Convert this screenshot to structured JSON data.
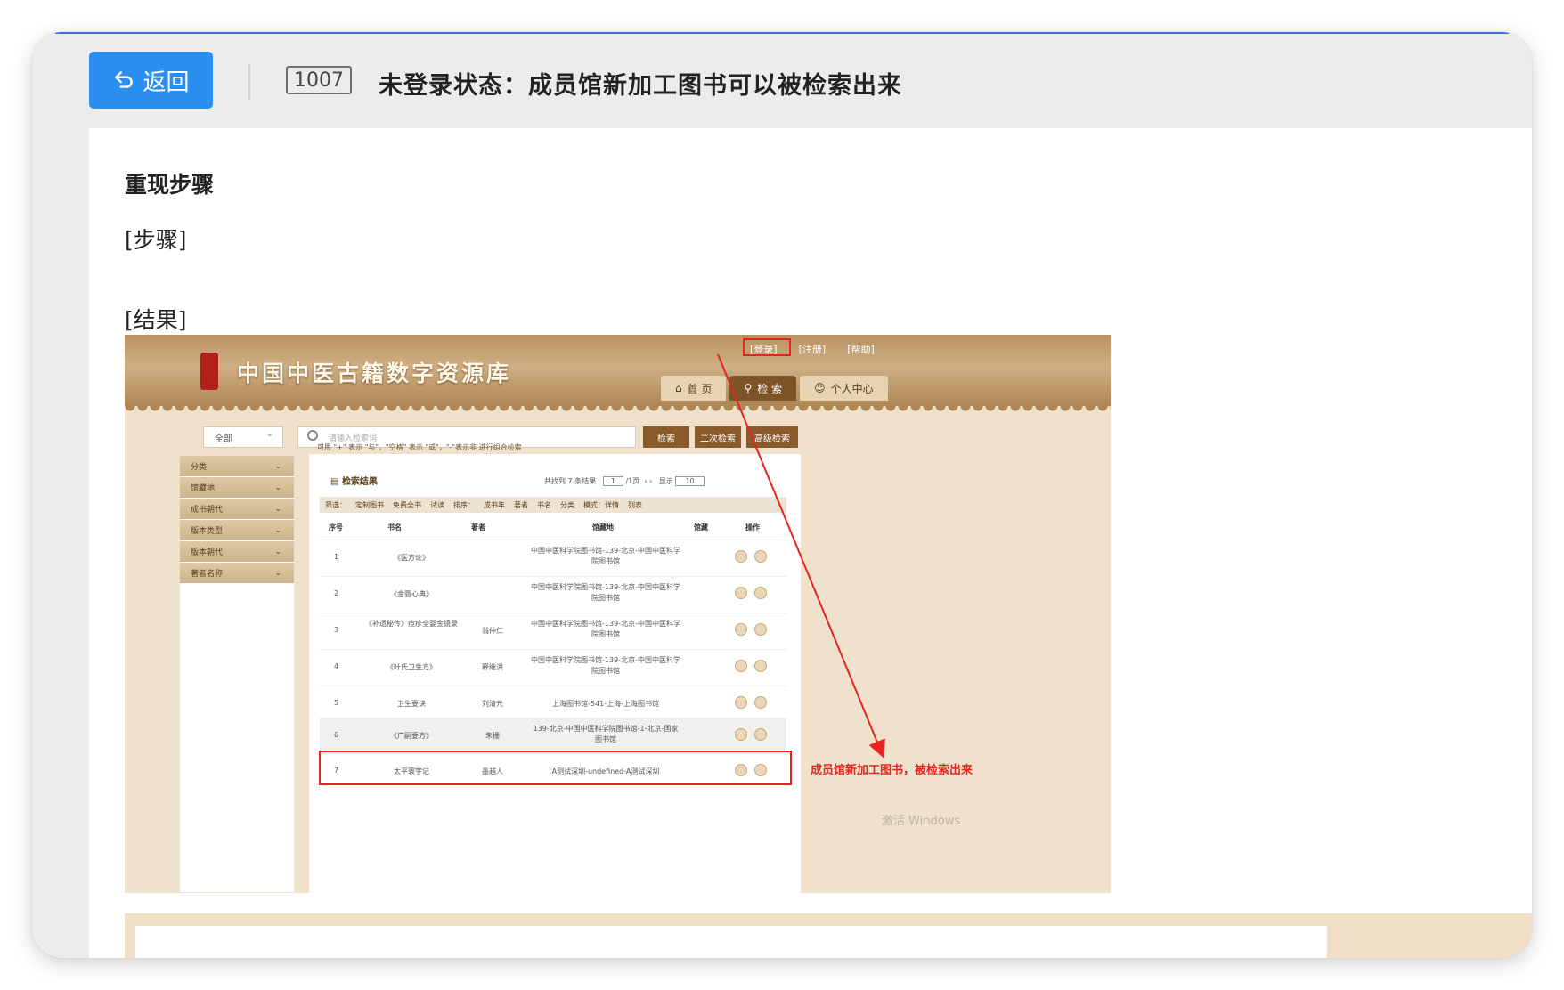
{
  "header": {
    "back_label": "返回",
    "issue_id": "1007",
    "issue_title": "未登录状态：成员馆新加工图书可以被检索出来"
  },
  "content": {
    "section_heading": "重现步骤",
    "steps_label": "[步骤]",
    "result_label": "[结果]"
  },
  "screenshot": {
    "site_title": "中国中医古籍数字资源库",
    "top_links": [
      "[登录]",
      "[注册]",
      "[帮助]"
    ],
    "nav_tabs": [
      "首 页",
      "检 索",
      "个人中心"
    ],
    "search_scope": "全部",
    "search_placeholder": "请输入检索词",
    "search_buttons": [
      "检索",
      "二次检索",
      "高级检索"
    ],
    "search_hint": "可用 \"+\" 表示 \"与\"，\"空格\" 表示 \"或\"，\"-\"表示非 进行组合检索",
    "left_filters": [
      "分类",
      "馆藏地",
      "成书朝代",
      "版本类型",
      "版本朝代",
      "著者名称"
    ],
    "result_title": "检索结果",
    "pager_text": "共找到 7 条结果",
    "pager_page": "1",
    "pager_pages": "/1页",
    "pager_per_page_label": "显示",
    "pager_per_page": "10",
    "filter_bar": [
      "筛选：",
      "定制图书",
      "免费全书",
      "试读",
      "排序：",
      "成书年",
      "著者",
      "书名",
      "分类",
      "模式：详情",
      "列表"
    ],
    "columns": [
      "序号",
      "书名",
      "著者",
      "馆藏地",
      "馆藏",
      "操作"
    ],
    "rows": [
      {
        "no": "1",
        "title": "《医方论》",
        "author": "",
        "holding": "中国中医科学院图书馆-139-北京-中国中医科学院图书馆"
      },
      {
        "no": "2",
        "title": "《金匮心典》",
        "author": "",
        "holding": "中国中医科学院图书馆-139-北京-中国中医科学院图书馆"
      },
      {
        "no": "3",
        "title": "《补遗秘传》痘疹全婴金镜录",
        "author": "翁仲仁",
        "holding": "中国中医科学院图书馆-139-北京-中国中医科学院图书馆"
      },
      {
        "no": "4",
        "title": "《叶氏卫生方》",
        "author": "释继洪",
        "holding": "中国中医科学院图书馆-139-北京-中国中医科学院图书馆"
      },
      {
        "no": "5",
        "title": "卫生要诀",
        "author": "刘清元",
        "holding": "上海图书馆-541-上海-上海图书馆"
      },
      {
        "no": "6",
        "title": "《广嗣要方》",
        "author": "朱栅",
        "holding": "139-北京-中国中医科学院图书馆-1-北京-国家图书馆"
      },
      {
        "no": "7",
        "title": "太平寰宇记",
        "author": "墨越人",
        "holding": "A测试深圳-undefined-A测试深圳"
      }
    ],
    "annotation": "成员馆新加工图书，被检索出来",
    "watermark": "激活 Windows",
    "colors": {
      "highlight": "#e52520",
      "brand_brown": "#8a5a2a"
    }
  }
}
